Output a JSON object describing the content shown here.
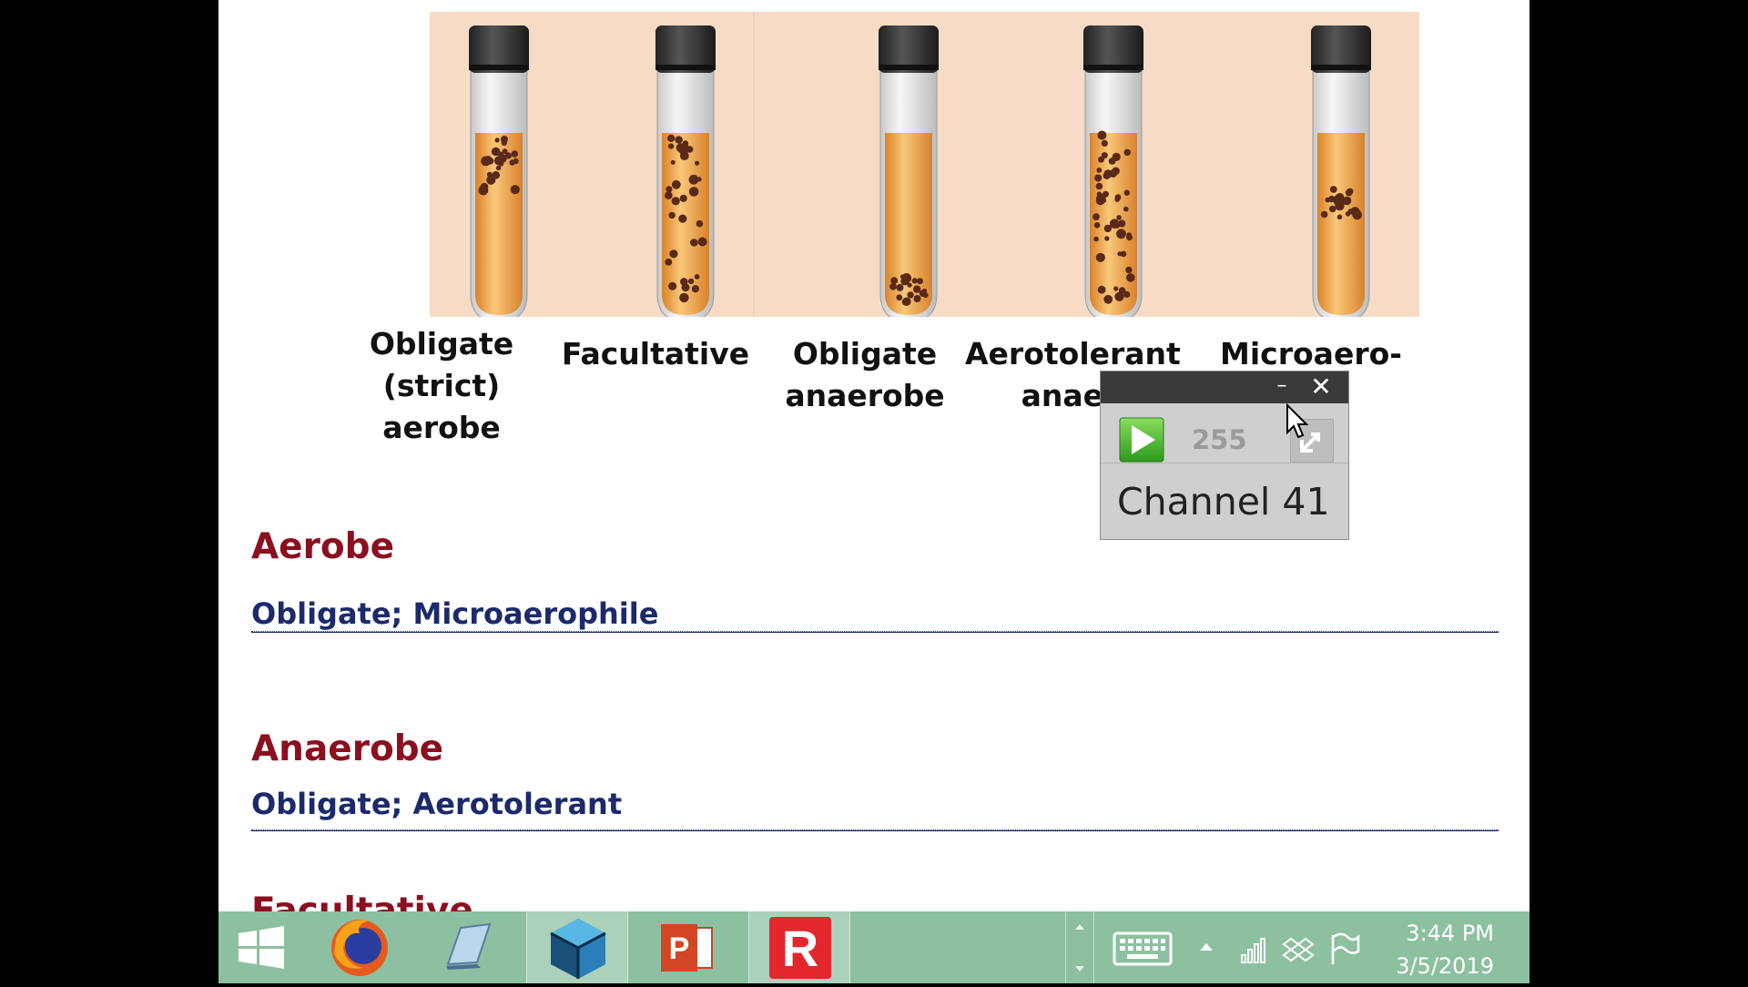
{
  "figure": {
    "tubes": [
      {
        "label": "Obligate\n(strict)\naerobe"
      },
      {
        "label": "Facultative"
      },
      {
        "label": "Obligate\nanaerobe"
      },
      {
        "label": "Aerotolerant\nanaer"
      },
      {
        "label": "Microaero-"
      }
    ]
  },
  "sections": [
    {
      "heading": "Aerobe",
      "items": "Obligate;  Microaerophile"
    },
    {
      "heading": "Anaerobe",
      "items": "Obligate;  Aerotolerant"
    },
    {
      "heading": "Facultative"
    }
  ],
  "widget": {
    "count": "255",
    "channel": "Channel 41",
    "minimize": "–",
    "close": "✕"
  },
  "taskbar": {
    "apps": [
      "windows-start",
      "firefox",
      "notepad",
      "sketchup",
      "powerpoint",
      "r-app"
    ],
    "time": "3:44 PM",
    "date": "3/5/2019"
  },
  "colors": {
    "heading": "#8b0f1f",
    "subline": "#1c2a6b",
    "figure_bg": "#f6dcc6",
    "taskbar": "#8dc0a0"
  }
}
